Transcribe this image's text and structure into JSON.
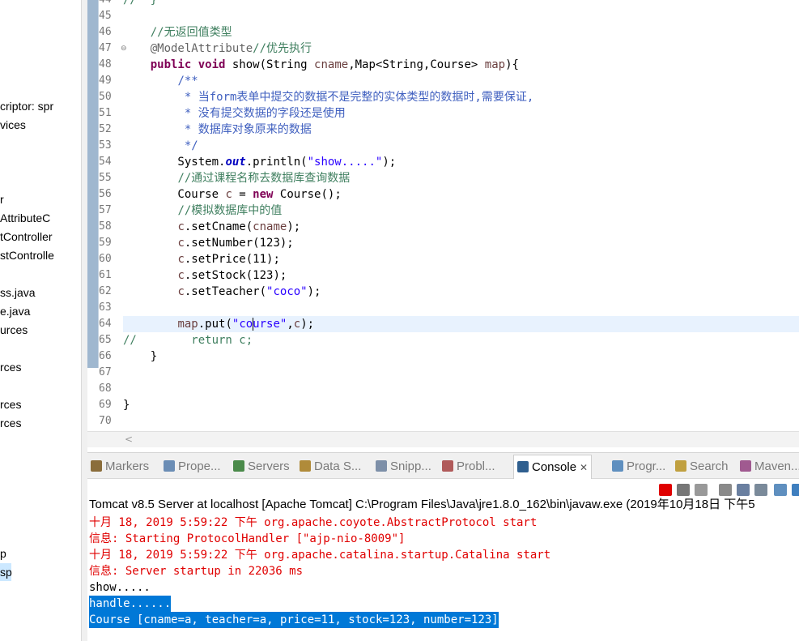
{
  "explorer": {
    "items": [
      {
        "label": "criptor: spr",
        "selected": false
      },
      {
        "label": "vices",
        "selected": false
      },
      {
        "label": "r",
        "selected": false
      },
      {
        "label": "AttributeC",
        "selected": false
      },
      {
        "label": "tController",
        "selected": false
      },
      {
        "label": "stControlle",
        "selected": false
      },
      {
        "label": "ss.java",
        "selected": false
      },
      {
        "label": "e.java",
        "selected": false
      },
      {
        "label": "urces",
        "selected": false
      },
      {
        "label": "rces",
        "selected": false
      },
      {
        "label": "rces",
        "selected": false
      },
      {
        "label": "rces",
        "selected": false
      },
      {
        "label": "p",
        "selected": false
      },
      {
        "label": "sp",
        "selected": true
      }
    ]
  },
  "editor": {
    "lines": [
      {
        "num": "44",
        "html": "<span class=\"cm\">//  }</span>"
      },
      {
        "num": "45",
        "html": ""
      },
      {
        "num": "46",
        "html": "    <span class=\"cm\">//无返回值类型</span>"
      },
      {
        "num": "47",
        "html": "    <span class=\"an\">@ModelAttribute</span><span class=\"cm\">//优先执行</span>",
        "fold": true
      },
      {
        "num": "48",
        "html": "    <span class=\"kw\">public</span> <span class=\"kw\">void</span> show(String <span class=\"var\">cname</span>,Map&lt;String,Course&gt; <span class=\"var\">map</span>){"
      },
      {
        "num": "49",
        "html": "        <span class=\"jd\">/**</span>"
      },
      {
        "num": "50",
        "html": "<span class=\"jd\">         * 当form表单中提交的数据不是完整的实体类型的数据时,需要保证,</span>"
      },
      {
        "num": "51",
        "html": "<span class=\"jd\">         * 没有提交数据的字段还是使用</span>"
      },
      {
        "num": "52",
        "html": "<span class=\"jd\">         * 数据库对象原来的数据</span>"
      },
      {
        "num": "53",
        "html": "<span class=\"jd\">         */</span>"
      },
      {
        "num": "54",
        "html": "        System.<span class=\"fld\">out</span>.println(<span class=\"st\">\"show.....\"</span>);"
      },
      {
        "num": "55",
        "html": "        <span class=\"cm\">//通过课程名称去数据库查询数据</span>"
      },
      {
        "num": "56",
        "html": "        Course <span class=\"var\">c</span> = <span class=\"kw\">new</span> Course();"
      },
      {
        "num": "57",
        "html": "        <span class=\"cm\">//模拟数据库中的值</span>"
      },
      {
        "num": "58",
        "html": "        <span class=\"var\">c</span>.setCname(<span class=\"var\">cname</span>);"
      },
      {
        "num": "59",
        "html": "        <span class=\"var\">c</span>.setNumber(123);"
      },
      {
        "num": "60",
        "html": "        <span class=\"var\">c</span>.setPrice(11);"
      },
      {
        "num": "61",
        "html": "        <span class=\"var\">c</span>.setStock(123);"
      },
      {
        "num": "62",
        "html": "        <span class=\"var\">c</span>.setTeacher(<span class=\"st\">\"coco\"</span>);"
      },
      {
        "num": "63",
        "html": ""
      },
      {
        "num": "64",
        "html": "        <span class=\"var\">map</span>.put(<span class=\"st\">\"course\"</span>,<span class=\"var\">c</span>);",
        "current": true
      },
      {
        "num": "65",
        "html": "<span class=\"cm\">//        return c;</span>"
      },
      {
        "num": "66",
        "html": "    }"
      },
      {
        "num": "67",
        "html": ""
      },
      {
        "num": "68",
        "html": ""
      },
      {
        "num": "69",
        "html": "}"
      },
      {
        "num": "70",
        "html": ""
      }
    ]
  },
  "panel": {
    "tabs": [
      {
        "label": "Markers",
        "color": "#8a6d3b"
      },
      {
        "label": "Prope...",
        "color": "#6b8db5"
      },
      {
        "label": "Servers",
        "color": "#4a8a4a"
      },
      {
        "label": "Data S...",
        "color": "#b08b3a"
      },
      {
        "label": "Snipp...",
        "color": "#7d8fa8"
      },
      {
        "label": "Probl...",
        "color": "#b05a5a"
      },
      {
        "label": "Console",
        "color": "#2f5f8f",
        "active": true
      },
      {
        "label": "Progr...",
        "color": "#5f8fbf"
      },
      {
        "label": "Search",
        "color": "#c0a040"
      },
      {
        "label": "Maven...",
        "color": "#a05a90"
      }
    ],
    "console_close": "✕",
    "console_title": "Tomcat v8.5 Server at localhost [Apache Tomcat] C:\\Program Files\\Java\\jre1.8.0_162\\bin\\javaw.exe (2019年10月18日 下午5",
    "output": [
      {
        "text": "十月 18, 2019 5:59:22 下午 org.apache.coyote.AbstractProtocol start",
        "kind": "err"
      },
      {
        "text": "信息: Starting ProtocolHandler [\"ajp-nio-8009\"]",
        "kind": "err"
      },
      {
        "text": "十月 18, 2019 5:59:22 下午 org.apache.catalina.startup.Catalina start",
        "kind": "err"
      },
      {
        "text": "信息: Server startup in 22036 ms",
        "kind": "err"
      },
      {
        "text": "show.....",
        "kind": "std"
      },
      {
        "text": "handle......",
        "kind": "sel"
      },
      {
        "text": "Course [cname=a, teacher=a, price=11, stock=123, number=123]",
        "kind": "sel"
      }
    ]
  },
  "toolbar": {
    "buttons": [
      {
        "name": "terminate-icon",
        "color": "#e00000"
      },
      {
        "name": "remove-launch-icon",
        "color": "#777777"
      },
      {
        "name": "remove-all-icon",
        "color": "#999999"
      },
      {
        "name": "clear-console-icon",
        "color": "#8a8a8a"
      },
      {
        "name": "scroll-lock-icon",
        "color": "#6a7fa0"
      },
      {
        "name": "word-wrap-icon",
        "color": "#7a8a9a"
      },
      {
        "name": "pin-console-icon",
        "color": "#5f8fbf"
      },
      {
        "name": "display-console-icon",
        "color": "#3f7fbf"
      }
    ]
  }
}
